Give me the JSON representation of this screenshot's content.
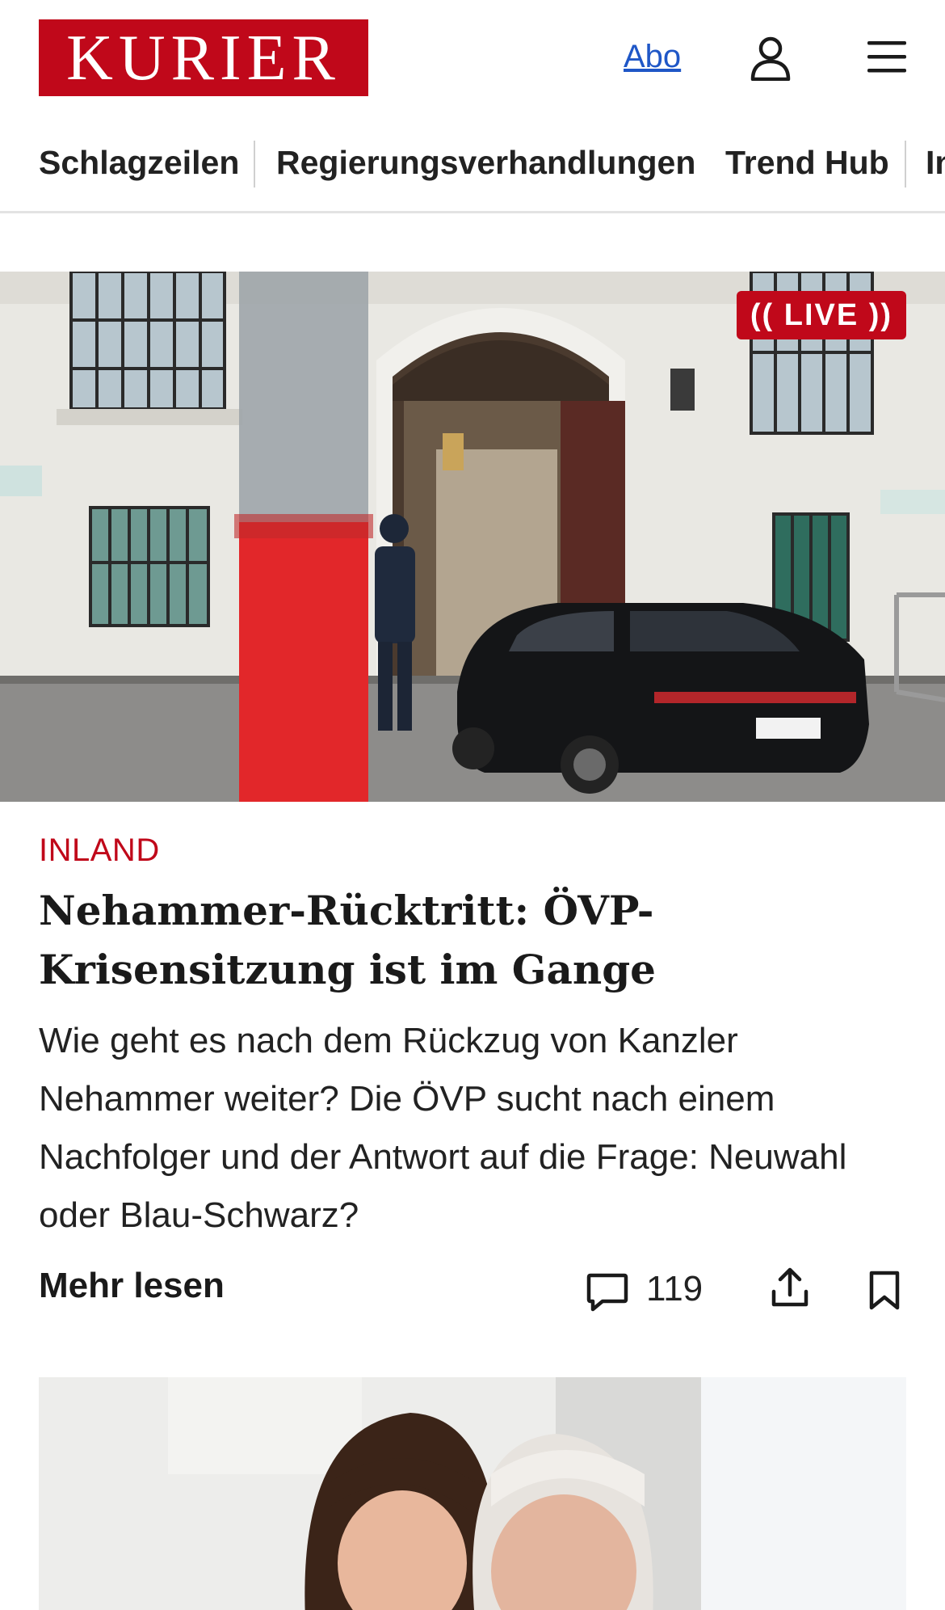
{
  "header": {
    "logo_text": "KURIER",
    "abo_label": "Abo",
    "brand_color": "#c0081a",
    "link_color": "#1f57c7",
    "icons": [
      "user-icon",
      "menu-icon"
    ]
  },
  "nav": {
    "items": [
      {
        "label": "Schlagzeilen"
      },
      {
        "label": "Regierungsverhandlungen"
      },
      {
        "label": "Trend Hub"
      },
      {
        "label": "In"
      }
    ]
  },
  "article": {
    "live_badge": "(( LIVE ))",
    "kicker": "INLAND",
    "title": "Nehammer-Rücktritt: ÖVP-Krisensitzung ist im Gange",
    "teaser": "Wie geht es nach dem Rückzug von Kanzler Nehammer weiter? Die ÖVP sucht nach einem Nachfolger und der Antwort auf die Frage: Neuwahl oder Blau-Schwarz?",
    "more_label": "Mehr lesen",
    "comment_count": "119",
    "icons": [
      "comment-icon",
      "share-icon",
      "bookmark-icon"
    ]
  }
}
